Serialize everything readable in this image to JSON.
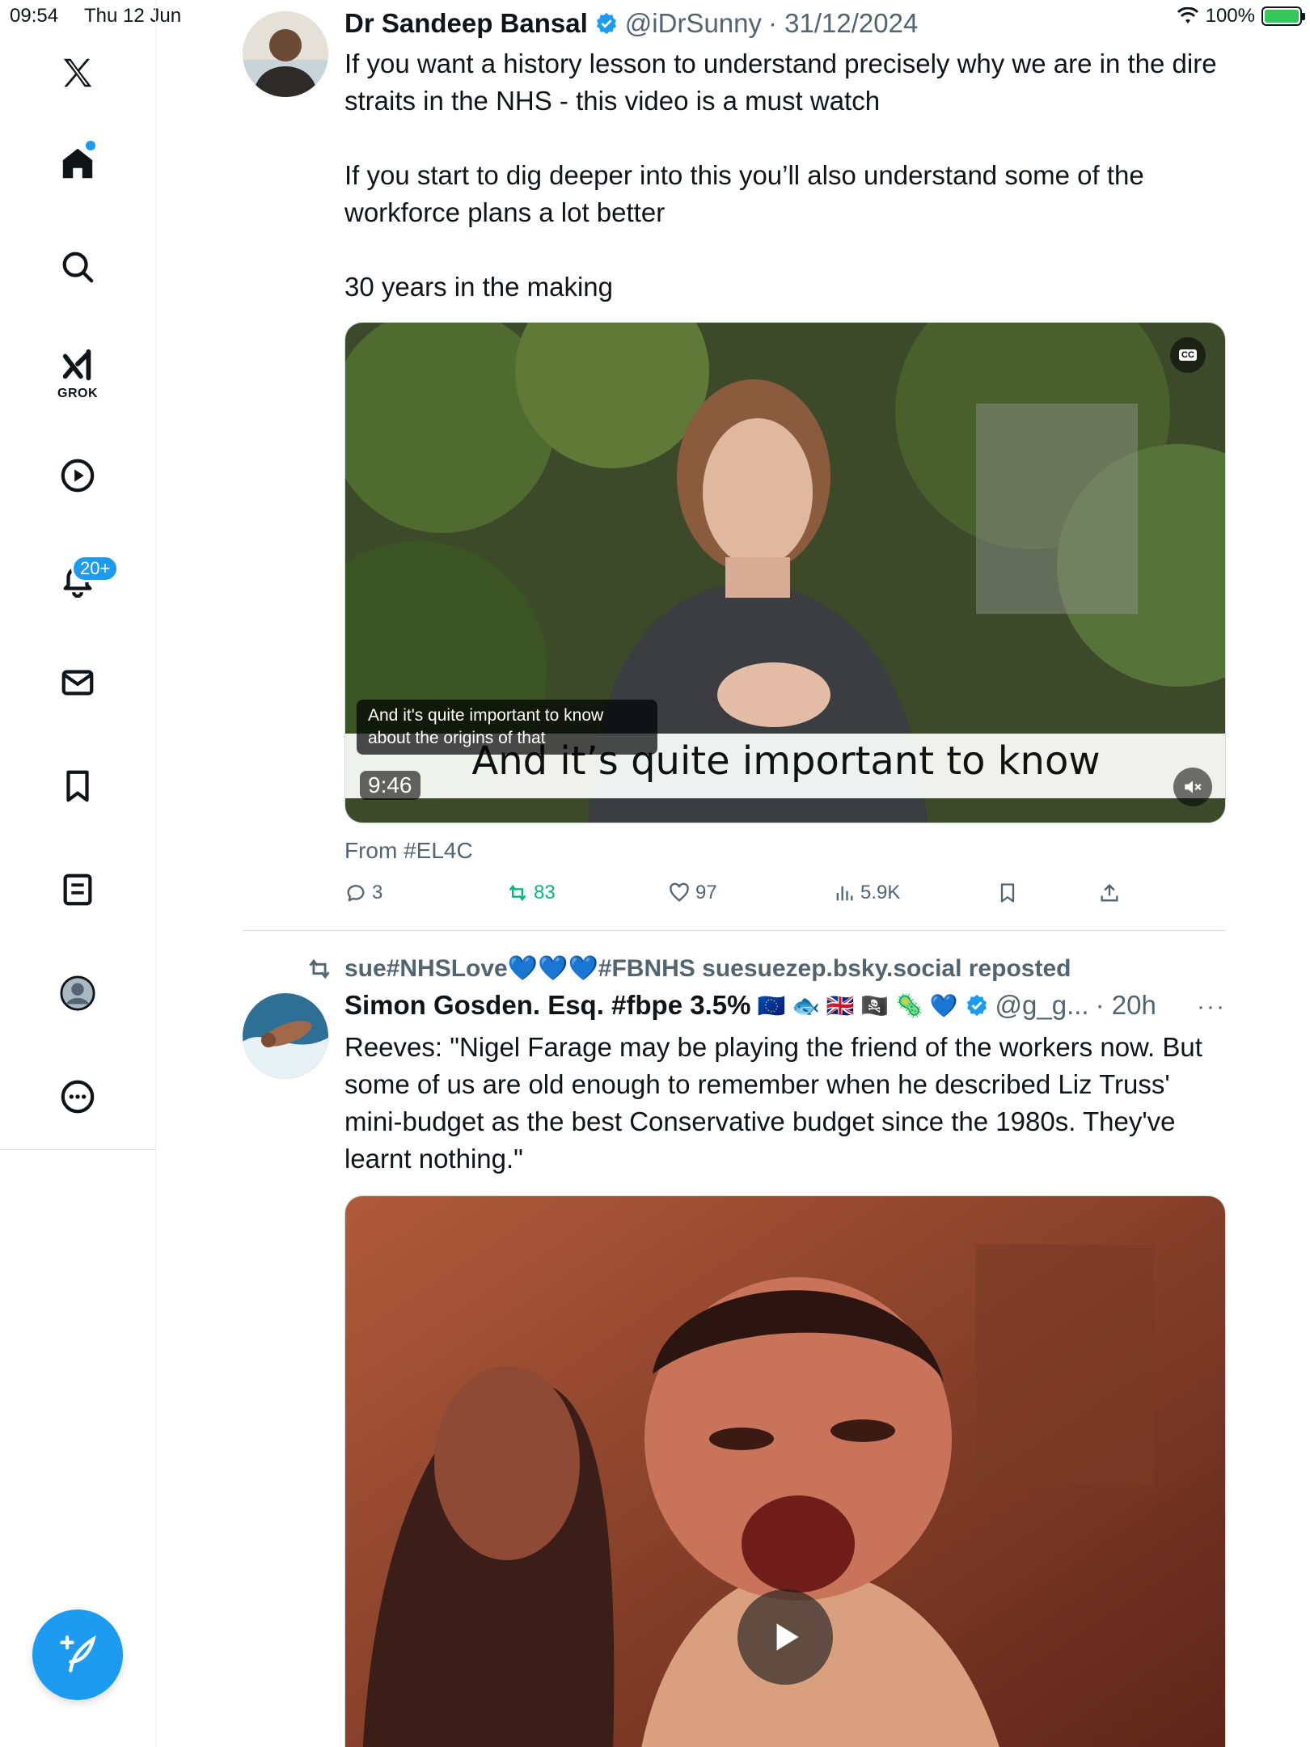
{
  "status_bar": {
    "time": "09:54",
    "date": "Thu 12 Jun",
    "battery": "100%"
  },
  "sidebar": {
    "grok_label": "GROK",
    "notifications_badge": "20+",
    "items": [
      "home",
      "explore",
      "grok",
      "videos",
      "notifications",
      "messages",
      "bookmarks",
      "lists",
      "profile",
      "more"
    ]
  },
  "tweet1": {
    "name": "Dr Sandeep Bansal",
    "handle": "@iDrSunny",
    "date": "· 31/12/2024",
    "text": "If you want a history lesson to understand precisely why we are in the dire straits in the NHS - this video is a must watch\n\nIf you start to dig deeper into this you’ll also understand some of the workforce plans a lot better\n\n30 years in the making",
    "video": {
      "cc_label": "CC",
      "caption_small": "And it's quite important to know about the origins of that",
      "caption_large": "And it’s quite important to know",
      "duration": "9:46"
    },
    "from": "From #EL4C",
    "replies": "3",
    "reposts": "83",
    "likes": "97",
    "views": "5.9K"
  },
  "tweet2": {
    "repost_by": "sue#NHSLove💙💙💙#FBNHS suesuezep.bsky.social reposted",
    "name": "Simon Gosden. Esq. #fbpe 3.5%",
    "flags": "🇪🇺 🐟 🇬🇧 🏴‍☠️ 🦠 💙",
    "handle": "@g_g...",
    "time": "· 20h",
    "more": "···",
    "text": "Reeves: \"Nigel Farage may be playing the friend of the workers now. But some of us are old enough to remember when he described Liz Truss' mini-budget as the best Conservative budget since the 1980s. They've learnt nothing.\""
  },
  "colors": {
    "accent": "#1d9bf0",
    "repost_green": "#00ba7c",
    "secondary_text": "#536471"
  }
}
